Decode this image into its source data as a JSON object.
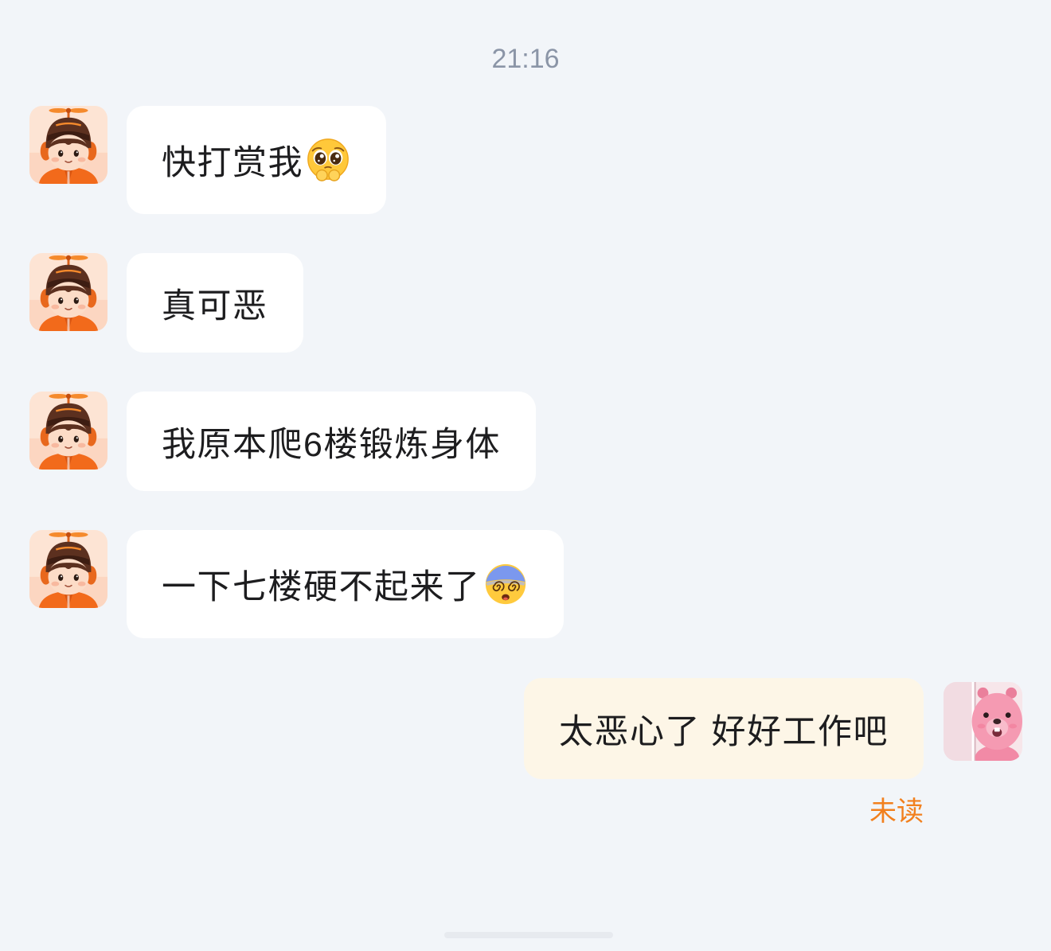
{
  "timestamp": "21:16",
  "colors": {
    "background": "#f2f5f9",
    "incoming_bubble": "#ffffff",
    "outgoing_bubble": "#fdf6e7",
    "timestamp_text": "#8b95a7",
    "read_status_text": "#f2801e"
  },
  "avatars": {
    "contact": "cartoon-boy-propeller-hat-avatar",
    "self": "pink-beaver-avatar"
  },
  "conversation": {
    "incoming": [
      {
        "text": "快打赏我",
        "emoji": "pleading-face-icon"
      },
      {
        "text": "真可恶"
      },
      {
        "text": "我原本爬6楼锻炼身体"
      },
      {
        "text": "一下七楼硬不起来了",
        "emoji": "dizzy-face-icon"
      }
    ],
    "outgoing": [
      {
        "text": "太恶心了 好好工作吧",
        "status": "未读"
      }
    ]
  }
}
